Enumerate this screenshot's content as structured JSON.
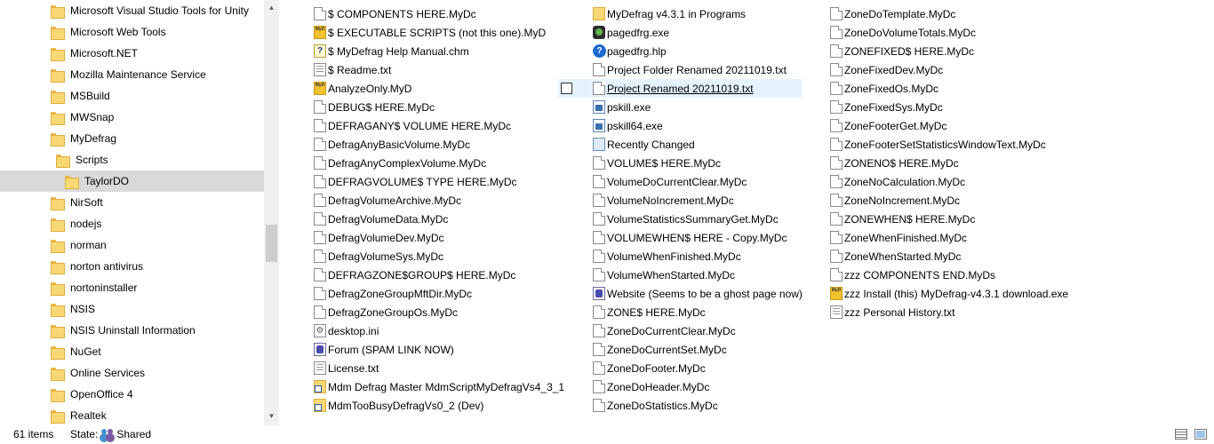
{
  "nav": {
    "items": [
      {
        "label": "Microsoft Visual Studio Tools for Unity"
      },
      {
        "label": "Microsoft Web Tools"
      },
      {
        "label": "Microsoft.NET"
      },
      {
        "label": "Mozilla Maintenance Service"
      },
      {
        "label": "MSBuild"
      },
      {
        "label": "MWSnap"
      },
      {
        "label": "MyDefrag"
      },
      {
        "label": "Scripts"
      },
      {
        "label": "TaylorDO"
      },
      {
        "label": "NirSoft"
      },
      {
        "label": "nodejs"
      },
      {
        "label": "norman"
      },
      {
        "label": "norton antivirus"
      },
      {
        "label": "nortoninstaller"
      },
      {
        "label": "NSIS"
      },
      {
        "label": "NSIS Uninstall Information"
      },
      {
        "label": "NuGet"
      },
      {
        "label": "Online Services"
      },
      {
        "label": "OpenOffice 4"
      },
      {
        "label": "Realtek"
      }
    ]
  },
  "files": {
    "col1": [
      {
        "name": "$ COMPONENTS HERE.MyDc",
        "icon": "document-icon"
      },
      {
        "name": "$ EXECUTABLE SCRIPTS (not this one).MyD",
        "icon": "mydefrag-script-icon"
      },
      {
        "name": "$ MyDefrag Help Manual.chm",
        "icon": "help-manual-icon"
      },
      {
        "name": "$ Readme.txt",
        "icon": "text-file-icon"
      },
      {
        "name": "AnalyzeOnly.MyD",
        "icon": "mydefrag-script-icon"
      },
      {
        "name": "DEBUG$ HERE.MyDc",
        "icon": "document-icon"
      },
      {
        "name": "DEFRAGANY$ VOLUME HERE.MyDc",
        "icon": "document-icon"
      },
      {
        "name": "DefragAnyBasicVolume.MyDc",
        "icon": "document-icon"
      },
      {
        "name": "DefragAnyComplexVolume.MyDc",
        "icon": "document-icon"
      },
      {
        "name": "DEFRAGVOLUME$ TYPE HERE.MyDc",
        "icon": "document-icon"
      },
      {
        "name": "DefragVolumeArchive.MyDc",
        "icon": "document-icon"
      },
      {
        "name": "DefragVolumeData.MyDc",
        "icon": "document-icon"
      },
      {
        "name": "DefragVolumeDev.MyDc",
        "icon": "document-icon"
      },
      {
        "name": "DefragVolumeSys.MyDc",
        "icon": "document-icon"
      },
      {
        "name": "DEFRAGZONE$GROUP$ HERE.MyDc",
        "icon": "document-icon"
      },
      {
        "name": "DefragZoneGroupMftDir.MyDc",
        "icon": "document-icon"
      },
      {
        "name": "DefragZoneGroupOs.MyDc",
        "icon": "document-icon"
      },
      {
        "name": "desktop.ini",
        "icon": "settings-file-icon"
      },
      {
        "name": "Forum (SPAM LINK NOW)",
        "icon": "internet-shortcut-icon"
      },
      {
        "name": "License.txt",
        "icon": "text-file-icon"
      },
      {
        "name": "Mdm Defrag Master MdmScriptMyDefragVs4_3_1",
        "icon": "shortcut-icon"
      },
      {
        "name": "MdmTooBusyDefragVs0_2 (Dev)",
        "icon": "shortcut-icon"
      }
    ],
    "col2": [
      {
        "name": "MyDefrag v4.3.1 in Programs",
        "icon": "program-shortcut-icon"
      },
      {
        "name": "pagedfrg.exe",
        "icon": "pagedfrg-icon"
      },
      {
        "name": "pagedfrg.hlp",
        "icon": "help-icon"
      },
      {
        "name": "Project Folder Renamed 20211019.txt",
        "icon": "document-icon"
      },
      {
        "name": "Project Renamed 20211019.txt",
        "icon": "document-icon"
      },
      {
        "name": "pskill.exe",
        "icon": "executable-icon"
      },
      {
        "name": "pskill64.exe",
        "icon": "executable-icon"
      },
      {
        "name": "Recently Changed",
        "icon": "saved-search-icon"
      },
      {
        "name": "VOLUME$ HERE.MyDc",
        "icon": "document-icon"
      },
      {
        "name": "VolumeDoCurrentClear.MyDc",
        "icon": "document-icon"
      },
      {
        "name": "VolumeNoIncrement.MyDc",
        "icon": "document-icon"
      },
      {
        "name": "VolumeStatisticsSummaryGet.MyDc",
        "icon": "document-icon"
      },
      {
        "name": "VOLUMEWHEN$ HERE - Copy.MyDc",
        "icon": "document-icon"
      },
      {
        "name": "VolumeWhenFinished.MyDc",
        "icon": "document-icon"
      },
      {
        "name": "VolumeWhenStarted.MyDc",
        "icon": "document-icon"
      },
      {
        "name": "Website (Seems to be a ghost page now)",
        "icon": "internet-shortcut-icon"
      },
      {
        "name": "ZONE$ HERE.MyDc",
        "icon": "document-icon"
      },
      {
        "name": "ZoneDoCurrentClear.MyDc",
        "icon": "document-icon"
      },
      {
        "name": "ZoneDoCurrentSet.MyDc",
        "icon": "document-icon"
      },
      {
        "name": "ZoneDoFooter.MyDc",
        "icon": "document-icon"
      },
      {
        "name": "ZoneDoHeader.MyDc",
        "icon": "document-icon"
      },
      {
        "name": "ZoneDoStatistics.MyDc",
        "icon": "document-icon"
      }
    ],
    "col3": [
      {
        "name": "ZoneDoTemplate.MyDc",
        "icon": "document-icon"
      },
      {
        "name": "ZoneDoVolumeTotals.MyDc",
        "icon": "document-icon"
      },
      {
        "name": "ZONEFIXED$ HERE.MyDc",
        "icon": "document-icon"
      },
      {
        "name": "ZoneFixedDev.MyDc",
        "icon": "document-icon"
      },
      {
        "name": "ZoneFixedOs.MyDc",
        "icon": "document-icon"
      },
      {
        "name": "ZoneFixedSys.MyDc",
        "icon": "document-icon"
      },
      {
        "name": "ZoneFooterGet.MyDc",
        "icon": "document-icon"
      },
      {
        "name": "ZoneFooterSetStatisticsWindowText.MyDc",
        "icon": "document-icon"
      },
      {
        "name": "ZONENO$ HERE.MyDc",
        "icon": "document-icon"
      },
      {
        "name": "ZoneNoCalculation.MyDc",
        "icon": "document-icon"
      },
      {
        "name": "ZoneNoIncrement.MyDc",
        "icon": "document-icon"
      },
      {
        "name": "ZONEWHEN$ HERE.MyDc",
        "icon": "document-icon"
      },
      {
        "name": "ZoneWhenFinished.MyDc",
        "icon": "document-icon"
      },
      {
        "name": "ZoneWhenStarted.MyDc",
        "icon": "document-icon"
      },
      {
        "name": "zzz COMPONENTS END.MyDs",
        "icon": "document-icon"
      },
      {
        "name": "zzz Install (this) MyDefrag-v4.3.1 download.exe",
        "icon": "mydefrag-script-icon"
      },
      {
        "name": "zzz Personal History.txt",
        "icon": "text-file-icon"
      }
    ]
  },
  "status": {
    "item_count": "61 items",
    "state_label": "State:",
    "state_value": "Shared"
  },
  "colors": {
    "selected_nav_bg": "#d9d9d9",
    "hover_item_bg": "#e5f3ff",
    "folder_yellow": "#f8d775"
  }
}
